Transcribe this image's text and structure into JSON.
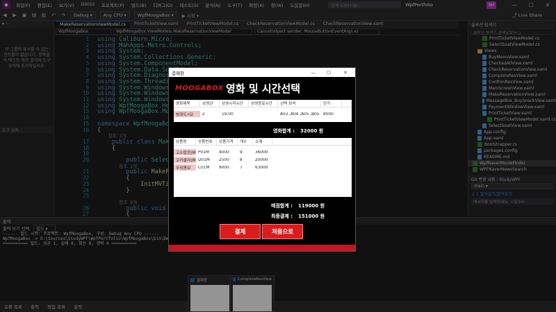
{
  "menu": {
    "items": [
      "파일(F)",
      "편집(E)",
      "보기(V)",
      "Git(G)",
      "프로젝트(P)",
      "빌드(B)",
      "디버그(D)",
      "테스트(S)",
      "분석(N)",
      "도구(T)",
      "확장(X)",
      "창(W)",
      "도움말(H)"
    ],
    "search_placeholder": "검색 (Ctrl+Q)",
    "window_title": "WpfPortfolio",
    "avatar": "SH"
  },
  "toolbar": {
    "config": "Debug",
    "platform": "Any CPU",
    "project": "WpfMoogaBox",
    "start": "▶ 시작 ▾",
    "live_share": "Live Share"
  },
  "left_panel": {
    "message": "이 그룹에 표시할 수 있는 컨트롤이 없습니다. 항목을 이 텍스트 위로 끌어와 도구 상자에 추가하십시오.",
    "tab": "도구 상자"
  },
  "editor": {
    "tabs": [
      "MakeReservationViewModel.cs",
      "PrintTicketView.xaml",
      "PrintTicketViewModel.cs",
      "CheckReservationViewModel.cs",
      "CheckReservationView.xaml"
    ],
    "nav": [
      "WpfMoogaBox",
      "WpfMoogaBox.ViewModels.MakeReservationViewModel",
      "Cancel(object sender, MouseButtonEventArgs e)"
    ],
    "lines": [
      {
        "n": "1",
        "t": "using Caliburn.Micro;"
      },
      {
        "n": "2",
        "t": "using MahApps.Metro.Controls;"
      },
      {
        "n": "3",
        "t": "using System;"
      },
      {
        "n": "4",
        "t": "using System.Collections.Generic;"
      },
      {
        "n": "5",
        "t": "using System.ComponentModel;"
      },
      {
        "n": "6",
        "t": "using System.Data.SqlClient;"
      },
      {
        "n": "7",
        "t": "using System.Diagnostics;"
      },
      {
        "n": "8",
        "t": "using System.Threading.Tasks;"
      },
      {
        "n": "9",
        "t": "using System.Windows;"
      },
      {
        "n": "10",
        "t": "using System.Windows.Controls;"
      },
      {
        "n": "11",
        "t": "using System.Windows.Input;"
      },
      {
        "n": "12",
        "t": "using WpfMoogaBox.Helpers;"
      },
      {
        "n": "13",
        "t": "using WpfMoogaBox.Models;"
      },
      {
        "n": "14",
        "t": ""
      },
      {
        "n": "15",
        "t": "namespace WpfMoogaBox.ViewModels"
      },
      {
        "n": "16",
        "t": "{"
      },
      {
        "n": "",
        "t": "    참조 3개"
      },
      {
        "n": "17",
        "t": "    public class MakeReservationViewModel"
      },
      {
        "n": "18",
        "t": "    {"
      },
      {
        "n": "19",
        "t": ""
      },
      {
        "n": "20",
        "t": "        public SelectionChanged"
      },
      {
        "n": "",
        "t": "        참조 2개"
      },
      {
        "n": "21",
        "t": "        public MakeReservationViewModel()"
      },
      {
        "n": "22",
        "t": "        {"
      },
      {
        "n": "23",
        "t": "            InitMVTimeList();"
      },
      {
        "n": "24",
        "t": "        }"
      },
      {
        "n": "25",
        "t": ""
      },
      {
        "n": "",
        "t": "        참조 0개"
      },
      {
        "n": "26",
        "t": "        public void ClickButton()"
      },
      {
        "n": "27",
        "t": "        {"
      }
    ]
  },
  "solution_explorer": {
    "title": "솔루션 탐색기",
    "search": "솔루션 탐색기 검색(Ctrl+;)",
    "items": [
      {
        "label": "PrintTicketViewModel.cs",
        "kind": "cs",
        "indent": 2
      },
      {
        "label": "SelectSeatViewModel.cs",
        "kind": "cs",
        "indent": 2
      },
      {
        "label": "Views",
        "kind": "folder",
        "indent": 1
      },
      {
        "label": "BuyMenuView.xaml",
        "kind": "file",
        "indent": 2
      },
      {
        "label": "CheckedAllView.xaml",
        "kind": "file",
        "indent": 2
      },
      {
        "label": "CheckReservationView.xaml",
        "kind": "file",
        "indent": 2
      },
      {
        "label": "CompleteResView.xaml",
        "kind": "file",
        "indent": 2
      },
      {
        "label": "ConfirmResView.xaml",
        "kind": "file",
        "indent": 2
      },
      {
        "label": "MainScreenView.xaml",
        "kind": "file",
        "indent": 2
      },
      {
        "label": "MakeReservationView.xaml",
        "kind": "file",
        "indent": 2
      },
      {
        "label": "MessageBox_BuySnackView.xaml",
        "kind": "file",
        "indent": 2
      },
      {
        "label": "PaymentWindowView.xaml",
        "kind": "file",
        "indent": 2
      },
      {
        "label": "PrintTicketView.xaml",
        "kind": "file",
        "indent": 2
      },
      {
        "label": "PrintTicketViewModel.xaml.cs",
        "kind": "cs",
        "indent": 3
      },
      {
        "label": "SelectSeatView.xaml",
        "kind": "file",
        "indent": 2
      },
      {
        "label": "App.config",
        "kind": "file",
        "indent": 1
      },
      {
        "label": "App.xaml",
        "kind": "file",
        "indent": 1
      },
      {
        "label": "Bootstrapper.cs",
        "kind": "cs",
        "indent": 1
      },
      {
        "label": "packages.config",
        "kind": "file",
        "indent": 1
      },
      {
        "label": "README.md",
        "kind": "file",
        "indent": 1
      },
      {
        "label": "WpfNaverMovieFinder",
        "kind": "cs",
        "indent": 0,
        "selected": true
      },
      {
        "label": "WPFNaverNewsSearch",
        "kind": "cs",
        "indent": 0
      }
    ]
  },
  "git": {
    "title": "Git 변경 내용 - StudyWPF",
    "branch": "main",
    "info": "↓ 1 밀어넣기/끌어오기",
    "commit_placeholder": "메시지를 입력하세요. <필수>"
  },
  "output": {
    "title": "출력",
    "source_label": "출력 보기 선택:",
    "source": "빌드",
    "lines": [
      "------ 빌드 시작: 프로젝트: WpfMoogaBox, 구성: Debug Any CPU ------",
      "  WpfMoogaBox -> D:\\Sources\\StudyWPF\\WpfPortfolio\\WpfMoogaBox\\bin\\Debug\\WpfMoogaBox.exe",
      "========== 빌드: 성공 1, 실패 0, 최신 0, 생략 0 =========="
    ]
  },
  "bottom_tabs": [
    "오류 목록",
    "출력",
    "작업 목록",
    "출력"
  ],
  "thumbnails": [
    {
      "title": "결제창"
    },
    {
      "title": "CompleteResView"
    }
  ],
  "dialog": {
    "title": "결제창",
    "brand": "MOOGABOX",
    "heading": "영화 및 시간선택",
    "movie_headers": [
      "영화제목",
      "상영관",
      "상영시작시간",
      "상영종료시간",
      "선택 좌석",
      "단가"
    ],
    "movie_row": [
      "범죄도시2",
      "2",
      "19:00",
      "",
      "A03 ,A04 ,A05 ,B05",
      "8000"
    ],
    "movie_total_label": "영화합계 :",
    "movie_total_value": "32000 원",
    "snack_headers": [
      "상품명",
      "상품번호",
      "상품가격",
      "개수",
      "소계"
    ],
    "snack_rows": [
      [
        "고소팝콘(M)",
        "P01M",
        "4000",
        "9",
        "36000"
      ],
      [
        "코카콜라(M)",
        "D01M",
        "2500",
        "8",
        "20000"
      ],
      [
        "무상콤보",
        "C01M",
        "9000",
        "7",
        "63000"
      ]
    ],
    "snack_total_label": "매점합계 :",
    "snack_total_value": "119000 원",
    "final_total_label": "최종결제 :",
    "final_total_value": "151000 원",
    "pay_button": "결제",
    "reset_button": "처음으로"
  }
}
